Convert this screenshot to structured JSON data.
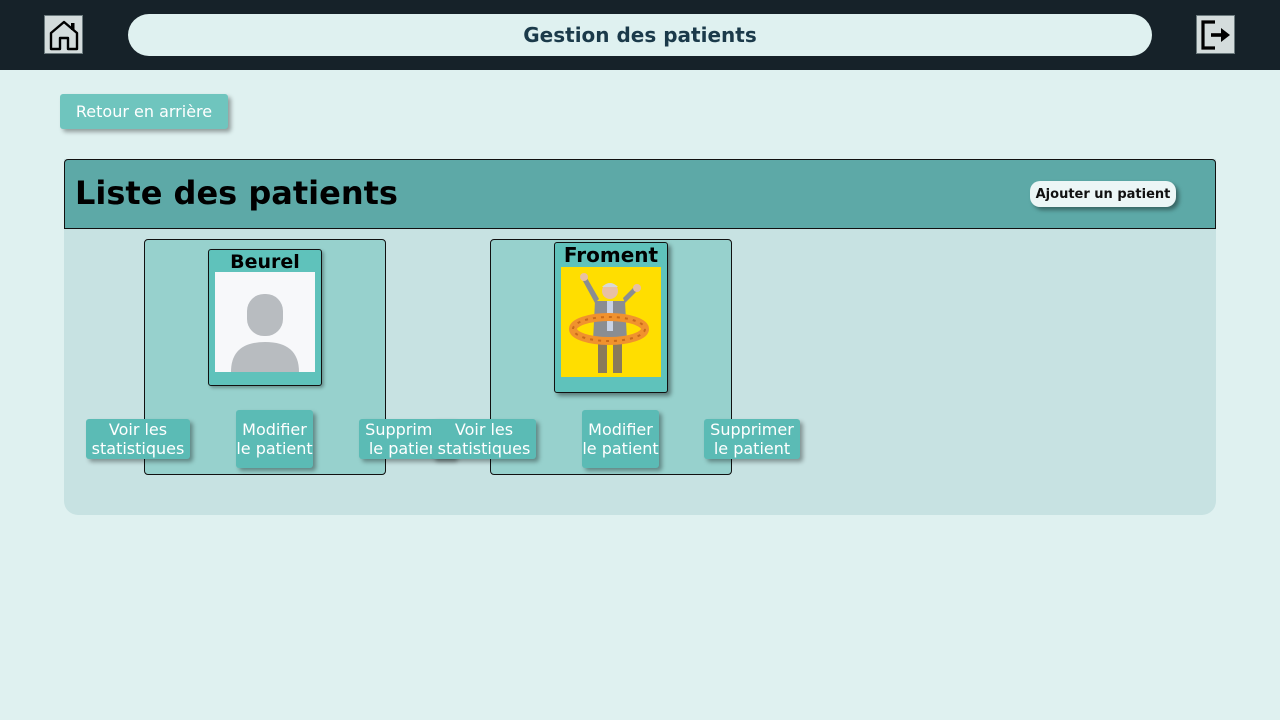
{
  "header": {
    "title": "Gestion des patients",
    "home_icon": "home-icon",
    "logout_icon": "logout-icon"
  },
  "back_button": "Retour en arrière",
  "list": {
    "title": "Liste des patients",
    "add_button": "Ajouter un patient"
  },
  "patients": [
    {
      "name": "Beurel",
      "photo": "avatar-placeholder",
      "actions": {
        "stats": "Voir les statistiques",
        "edit": "Modifier le patient",
        "delete": "Supprimer le patient"
      }
    },
    {
      "name": "Froment",
      "photo": "photo",
      "actions": {
        "stats": "Voir les statistiques",
        "edit": "Modifier le patient",
        "delete": "Supprimer le patient"
      }
    }
  ],
  "colors": {
    "topbar": "#162229",
    "background": "#dff1f0",
    "button": "#6fc5be",
    "header": "#5da9a7",
    "card": "#97d1cd"
  }
}
